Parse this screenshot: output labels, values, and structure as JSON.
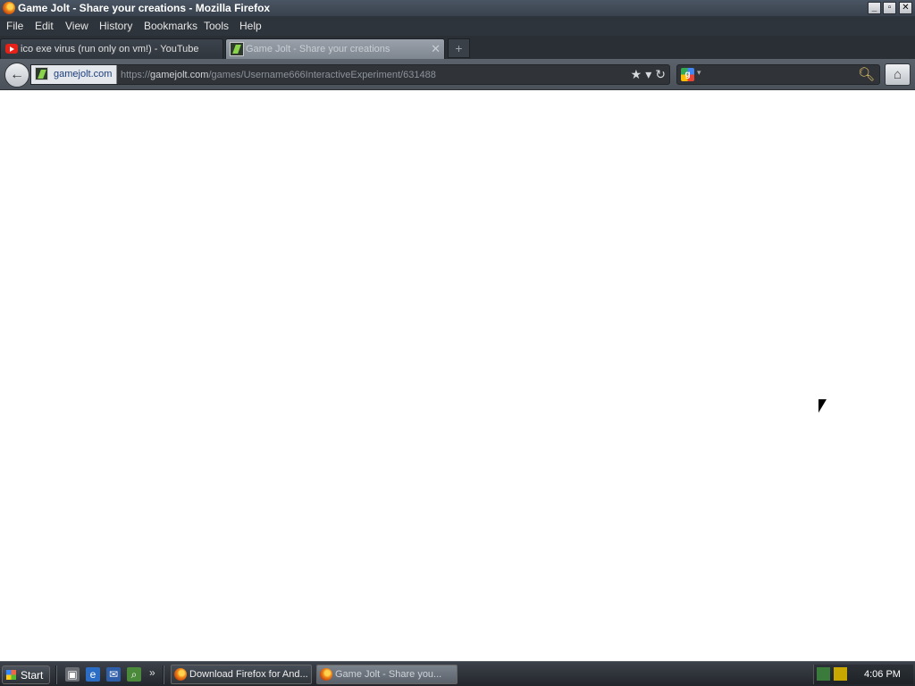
{
  "window": {
    "title": "Game Jolt - Share your creations - Mozilla Firefox",
    "controls": [
      "_",
      "▫",
      "✕"
    ]
  },
  "menu": [
    {
      "label": "File",
      "accel": "F"
    },
    {
      "label": "Edit",
      "accel": "E"
    },
    {
      "label": "View",
      "accel": "V"
    },
    {
      "label": "History",
      "accel": "H"
    },
    {
      "label": "Bookmarks",
      "accel": "B"
    },
    {
      "label": "Tools",
      "accel": "T"
    },
    {
      "label": "Help",
      "accel": "H"
    }
  ],
  "tabs": [
    {
      "label": "ico exe virus (run only on vm!) - YouTube",
      "icon": "youtube-icon",
      "active": false
    },
    {
      "label": "Game Jolt - Share your creations",
      "icon": "gamejolt-icon",
      "active": true
    }
  ],
  "new_tab_label": "+",
  "navigation": {
    "identity_domain": "gamejolt.com",
    "url_prefix": "https://",
    "url_host": "gamejolt.com",
    "url_path": "/games/Username666InteractiveExperiment/631488",
    "search_placeholder": "",
    "search_engine": "google-icon"
  },
  "taskbar": {
    "start_label": "Start",
    "quick_launch": [
      "show-desktop-icon",
      "internet-explorer-icon",
      "outlook-icon",
      "search-icon"
    ],
    "more": "»",
    "tasks": [
      {
        "label": "Download Firefox for And...",
        "active": false
      },
      {
        "label": "Game Jolt - Share you...",
        "active": true
      }
    ],
    "clock": "4:06 PM"
  },
  "colors": {
    "chrome_dark": "#2e343b",
    "tab_active": "#8c939c",
    "content_bg": "#ffffff"
  }
}
